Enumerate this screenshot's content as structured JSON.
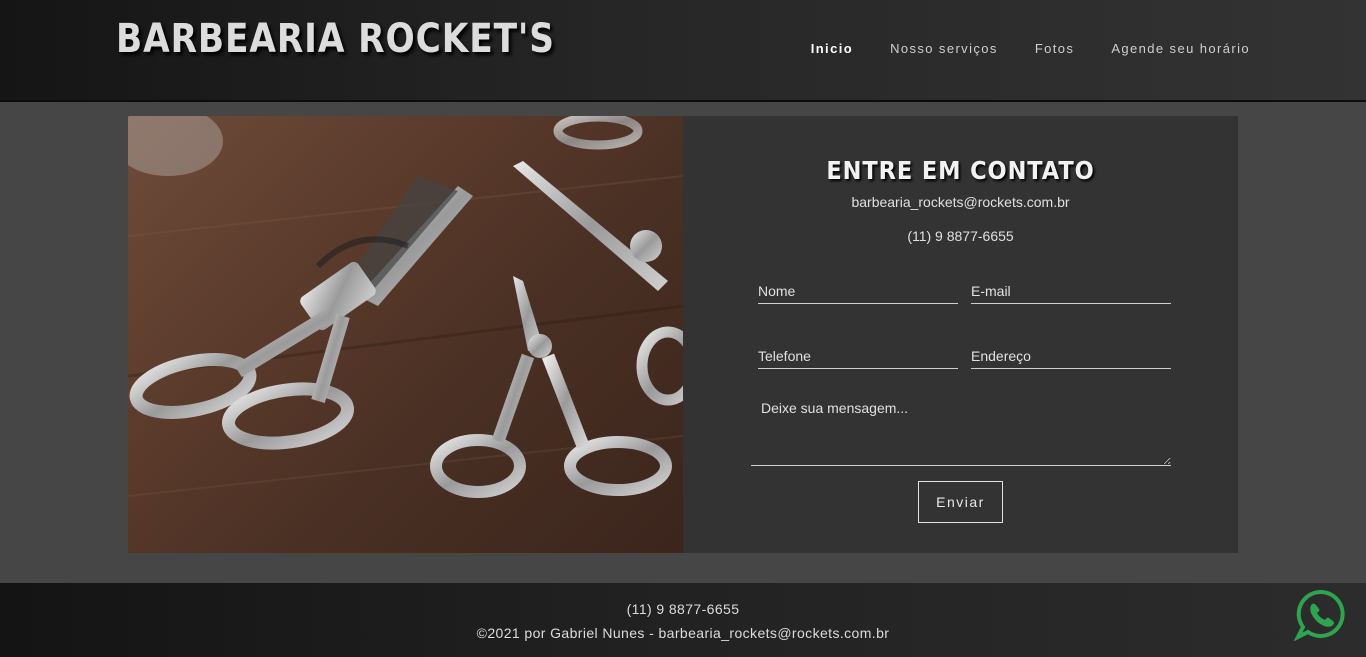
{
  "header": {
    "brand": "BARBEARIA ROCKET'S",
    "nav": [
      {
        "label": "Inicio",
        "active": true
      },
      {
        "label": "Nosso serviços",
        "active": false
      },
      {
        "label": "Fotos",
        "active": false
      },
      {
        "label": "Agende seu horário",
        "active": false
      }
    ]
  },
  "contact": {
    "title": "ENTRE EM CONTATO",
    "email": "barbearia_rockets@rockets.com.br",
    "phone": "(11) 9 8877-6655",
    "form": {
      "name_placeholder": "Nome",
      "email_placeholder": "E-mail",
      "phone_placeholder": "Telefone",
      "address_placeholder": "Endereço",
      "message_placeholder": "Deixe sua mensagem...",
      "submit_label": "Enviar"
    }
  },
  "footer": {
    "phone": "(11) 9 8877-6655",
    "copyright": "©2021 por Gabriel Nunes - barbearia_rockets@rockets.com.br"
  },
  "icons": {
    "whatsapp": "whatsapp-icon",
    "whatsapp_color": "#2ea44f"
  },
  "colors": {
    "page_bg": "#464646",
    "panel_bg": "#333333"
  }
}
